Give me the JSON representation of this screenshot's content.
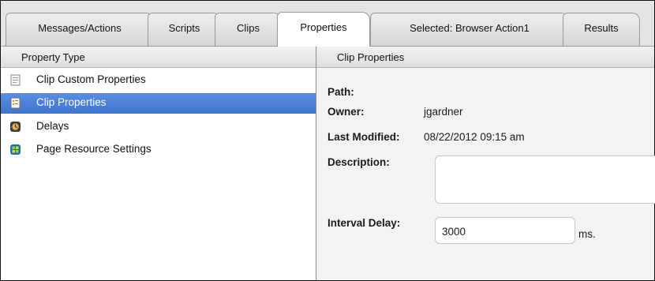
{
  "tabs": [
    {
      "label": "Messages/Actions"
    },
    {
      "label": "Scripts"
    },
    {
      "label": "Clips"
    },
    {
      "label": "Properties"
    },
    {
      "label": "Selected: Browser Action1"
    },
    {
      "label": "Results"
    }
  ],
  "active_tab": "Properties",
  "left_panel": {
    "header": "Property Type",
    "items": [
      {
        "label": "Clip Custom Properties",
        "icon": "document-icon"
      },
      {
        "label": "Clip Properties",
        "icon": "properties-icon",
        "selected": true
      },
      {
        "label": "Delays",
        "icon": "delay-icon"
      },
      {
        "label": "Page Resource Settings",
        "icon": "page-resource-icon"
      }
    ]
  },
  "right_panel": {
    "header": "Clip Properties",
    "path_label": "Path:",
    "path_value": "",
    "owner_label": "Owner:",
    "owner_value": "jgardner",
    "modified_label": "Last Modified:",
    "modified_value": "08/22/2012 09:15 am",
    "description_label": "Description:",
    "description_value": "",
    "interval_label": "Interval Delay:",
    "interval_value": "3000",
    "interval_unit": "ms."
  },
  "colors": {
    "selection": "#4a80d8",
    "right_panel_bg": "#f3f3f3",
    "tab_bar_bg": "#e4e4e4"
  }
}
